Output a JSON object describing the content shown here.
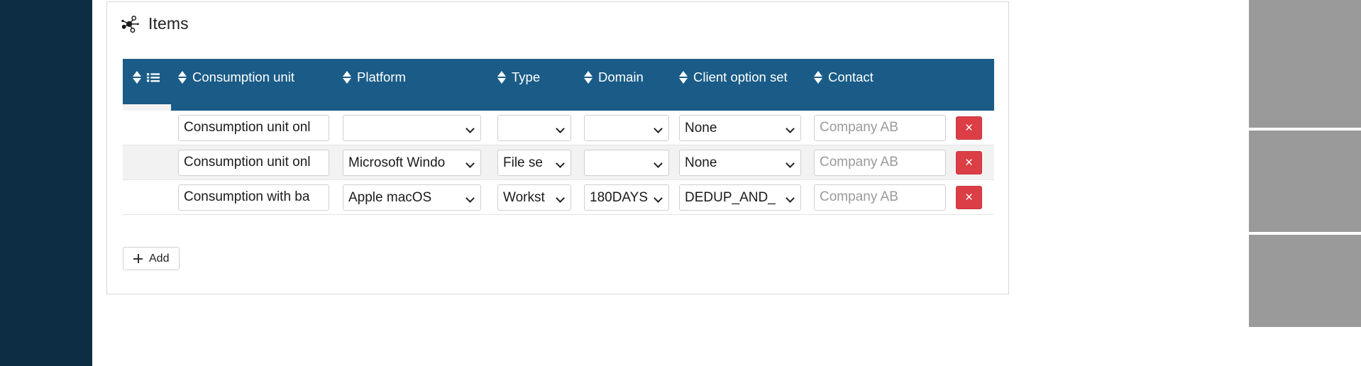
{
  "card": {
    "title": "Items",
    "title_icon": "network-graph-icon"
  },
  "table": {
    "columns": [
      {
        "key": "select",
        "label": "",
        "icon": "list-checklist-icon",
        "sortable": true
      },
      {
        "key": "unit",
        "label": "Consumption unit",
        "sortable": true
      },
      {
        "key": "platform",
        "label": "Platform",
        "sortable": true
      },
      {
        "key": "type",
        "label": "Type",
        "sortable": true
      },
      {
        "key": "domain",
        "label": "Domain",
        "sortable": true
      },
      {
        "key": "cos",
        "label": "Client option set",
        "sortable": true
      },
      {
        "key": "contact",
        "label": "Contact",
        "sortable": true
      },
      {
        "key": "delete",
        "label": "",
        "sortable": false
      }
    ],
    "rows": [
      {
        "unit": "Consumption unit onl",
        "platform": "",
        "type": "",
        "domain": "",
        "cos": "None",
        "contact": "",
        "contact_placeholder": "Company AB",
        "delete_label": "×"
      },
      {
        "unit": "Consumption unit onl",
        "platform": "Microsoft Windo",
        "type": "File se",
        "domain": "",
        "cos": "None",
        "contact": "",
        "contact_placeholder": "Company AB",
        "delete_label": "×"
      },
      {
        "unit": "Consumption with ba",
        "platform": "Apple macOS",
        "type": "Workst",
        "domain": "180DAYS",
        "cos": "DEDUP_AND_",
        "contact": "",
        "contact_placeholder": "Company AB",
        "delete_label": "×"
      }
    ]
  },
  "add_button": {
    "label": "Add",
    "icon": "plus-icon"
  },
  "colors": {
    "header_blue": "#1a5c87",
    "sidebar_navy": "#0d2d44",
    "delete_red": "#dc3e45",
    "alt_row": "#f2f2f2"
  }
}
